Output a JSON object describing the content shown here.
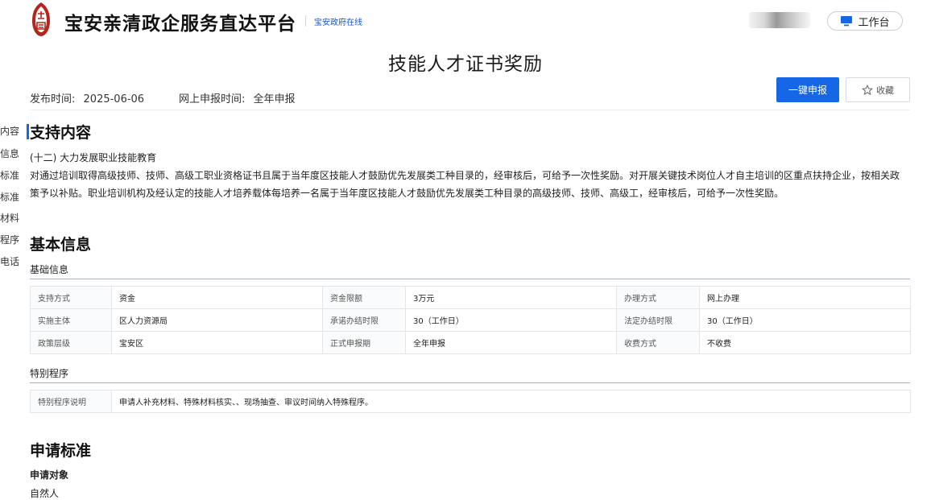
{
  "header": {
    "site_title": "宝安亲清政企服务直达平台",
    "site_link": "宝安政府在线",
    "workbench_label": "工作台"
  },
  "page": {
    "title": "技能人才证书奖励",
    "publish_label": "发布时间:",
    "publish_date": "2025-06-06",
    "online_label": "网上申报时间:",
    "online_value": "全年申报",
    "apply_label": "一键申报",
    "favorite_label": "收藏"
  },
  "side_nav": {
    "items": [
      "内容",
      "信息",
      "标准",
      "标准",
      "材料",
      "程序",
      "电话"
    ]
  },
  "support": {
    "heading": "支持内容",
    "item_title": "(十二) 大力发展职业技能教育",
    "body": "对通过培训取得高级技师、技师、高级工职业资格证书且属于当年度区技能人才鼓励优先发展类工种目录的，经审核后，可给予一次性奖励。对开展关键技术岗位人才自主培训的区重点扶持企业，按相关政策予以补贴。职业培训机构及经认定的技能人才培养载体每培养一名属于当年度区技能人才鼓励优先发展类工种目录的高级技师、技师、高级工，经审核后，可给予一次性奖励。"
  },
  "basic": {
    "heading": "基本信息",
    "sub_basic": "基础信息",
    "rows": [
      [
        {
          "k": "支持方式",
          "v": "资金"
        },
        {
          "k": "资金限额",
          "v": "3万元"
        },
        {
          "k": "办理方式",
          "v": "网上办理"
        }
      ],
      [
        {
          "k": "实施主体",
          "v": "区人力资源局"
        },
        {
          "k": "承诺办结时限",
          "v": "30（工作日）"
        },
        {
          "k": "法定办结时限",
          "v": "30（工作日）"
        }
      ],
      [
        {
          "k": "政策层级",
          "v": "宝安区"
        },
        {
          "k": "正式申报期",
          "v": "全年申报"
        },
        {
          "k": "收费方式",
          "v": "不收费"
        }
      ]
    ],
    "sub_special": "特别程序",
    "special_key": "特别程序说明",
    "special_value": "申请人补充材料、特殊材料核实、、现场抽查、审议时间纳入特殊程序。"
  },
  "standard": {
    "heading": "申请标准",
    "target_label": "申请对象",
    "target_value": "自然人"
  },
  "colors": {
    "primary": "#1667e6",
    "logo_red": "#b3261e"
  }
}
